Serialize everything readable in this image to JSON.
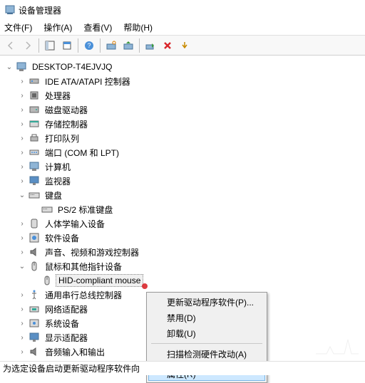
{
  "window": {
    "title": "设备管理器"
  },
  "menu": {
    "file": "文件(F)",
    "action": "操作(A)",
    "view": "查看(V)",
    "help": "帮助(H)"
  },
  "tree": {
    "root": "DESKTOP-T4EJVJQ",
    "nodes": [
      {
        "label": "IDE ATA/ATAPI 控制器",
        "expanded": false,
        "icon": "ide"
      },
      {
        "label": "处理器",
        "expanded": false,
        "icon": "cpu"
      },
      {
        "label": "磁盘驱动器",
        "expanded": false,
        "icon": "disk"
      },
      {
        "label": "存储控制器",
        "expanded": false,
        "icon": "storage"
      },
      {
        "label": "打印队列",
        "expanded": false,
        "icon": "printer"
      },
      {
        "label": "端口 (COM 和 LPT)",
        "expanded": false,
        "icon": "port"
      },
      {
        "label": "计算机",
        "expanded": false,
        "icon": "computer"
      },
      {
        "label": "监视器",
        "expanded": false,
        "icon": "monitor"
      },
      {
        "label": "键盘",
        "expanded": true,
        "icon": "keyboard",
        "children": [
          {
            "label": "PS/2 标准键盘",
            "icon": "keyboard"
          }
        ]
      },
      {
        "label": "人体学输入设备",
        "expanded": false,
        "icon": "hid"
      },
      {
        "label": "软件设备",
        "expanded": false,
        "icon": "software"
      },
      {
        "label": "声音、视频和游戏控制器",
        "expanded": false,
        "icon": "audio"
      },
      {
        "label": "鼠标和其他指针设备",
        "expanded": true,
        "icon": "mouse",
        "children": [
          {
            "label": "HID-compliant mouse",
            "icon": "mouse",
            "selected": true
          }
        ]
      },
      {
        "label": "通用串行总线控制器",
        "expanded": false,
        "icon": "usb"
      },
      {
        "label": "网络适配器",
        "expanded": false,
        "icon": "network"
      },
      {
        "label": "系统设备",
        "expanded": false,
        "icon": "system"
      },
      {
        "label": "显示适配器",
        "expanded": false,
        "icon": "display"
      },
      {
        "label": "音频输入和输出",
        "expanded": false,
        "icon": "audio"
      }
    ]
  },
  "context_menu": {
    "update_driver": "更新驱动程序软件(P)...",
    "disable": "禁用(D)",
    "uninstall": "卸载(U)",
    "scan_hw": "扫描检测硬件改动(A)",
    "properties": "属性(R)"
  },
  "statusbar": {
    "text": "为选定设备启动更新驱动程序软件向"
  }
}
